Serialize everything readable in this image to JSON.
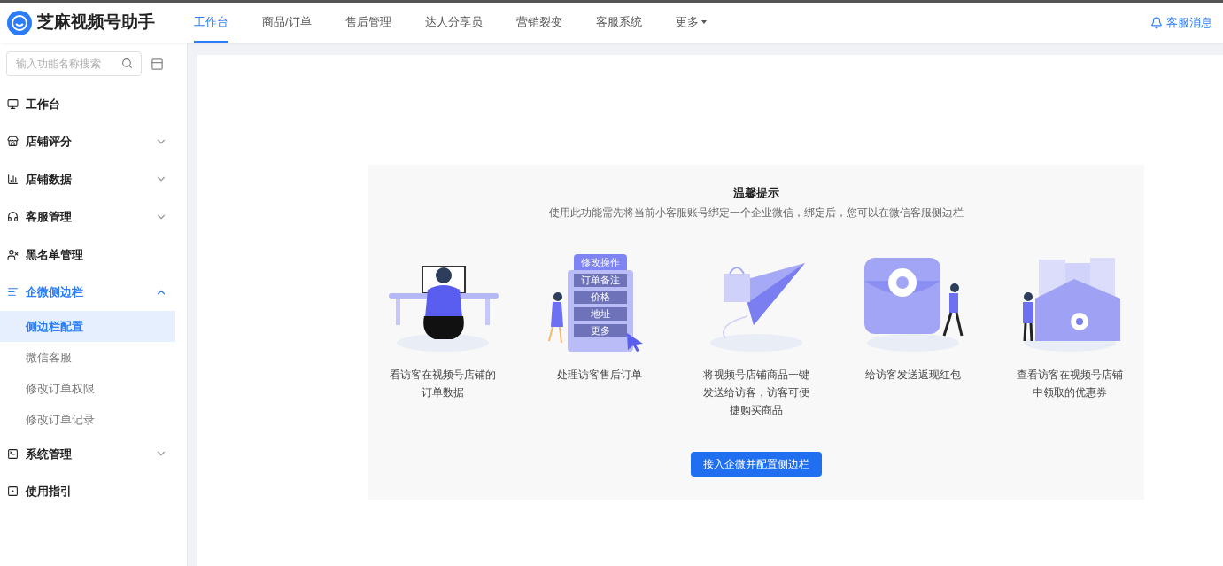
{
  "app": {
    "name": "芝麻视频号助手"
  },
  "nav": [
    {
      "label": "工作台",
      "selected": true,
      "kind": "tab"
    },
    {
      "label": "商品/订单",
      "selected": false,
      "kind": "tab"
    },
    {
      "label": "售后管理",
      "selected": false,
      "kind": "tab"
    },
    {
      "label": "达人分享员",
      "selected": false,
      "kind": "tab"
    },
    {
      "label": "营销裂变",
      "selected": false,
      "kind": "tab"
    },
    {
      "label": "客服系统",
      "selected": false,
      "kind": "tab"
    },
    {
      "label": "更多",
      "selected": false,
      "kind": "dropdown"
    }
  ],
  "notice": {
    "label": "客服消息"
  },
  "search": {
    "placeholder": "输入功能名称搜索"
  },
  "sidebar": {
    "items": [
      {
        "label": "工作台",
        "kind": "link",
        "selected": false
      },
      {
        "label": "店铺评分",
        "kind": "group",
        "expanded": false,
        "selected": false
      },
      {
        "label": "店铺数据",
        "kind": "group",
        "expanded": false,
        "selected": false
      },
      {
        "label": "客服管理",
        "kind": "group",
        "expanded": false,
        "selected": false
      },
      {
        "label": "黑名单管理",
        "kind": "link",
        "selected": false
      },
      {
        "label": "企微侧边栏",
        "kind": "group",
        "expanded": true,
        "selected": true,
        "children": [
          {
            "label": "侧边栏配置",
            "selected": true
          },
          {
            "label": "微信客服",
            "selected": false
          },
          {
            "label": "修改订单权限",
            "selected": false
          },
          {
            "label": "修改订单记录",
            "selected": false
          }
        ]
      },
      {
        "label": "系统管理",
        "kind": "group",
        "expanded": false,
        "selected": false
      },
      {
        "label": "使用指引",
        "kind": "link",
        "selected": false
      }
    ]
  },
  "tip": {
    "title": "温馨提示",
    "text": "使用此功能需先将当前小客服账号绑定一个企业微信，绑定后，您可以在微信客服侧边栏"
  },
  "features": [
    {
      "kind": "desk",
      "caption": "看访客在视频号店铺的订单数据"
    },
    {
      "kind": "menu",
      "caption": "处理访客售后订单",
      "menu_title": "修改操作",
      "menu_items": [
        "订单备注",
        "价格",
        "地址",
        "更多"
      ]
    },
    {
      "kind": "plane",
      "caption": "将视频号店铺商品一键发送给访客，访客可便捷购买商品"
    },
    {
      "kind": "redpacket",
      "caption": "给访客发送返现红包"
    },
    {
      "kind": "coupon",
      "caption": "查看访客在视频号店铺中领取的优惠券"
    }
  ],
  "action": {
    "label": "接入企微并配置侧边栏"
  }
}
